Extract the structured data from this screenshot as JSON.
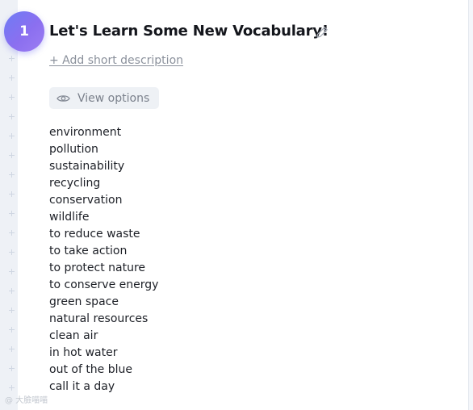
{
  "section": {
    "number": "1",
    "title": "Let's Learn Some New Vocabulary!",
    "add_description_link": "+ Add short description",
    "view_options_label": "View options"
  },
  "vocabulary": [
    "environment",
    "pollution",
    "sustainability",
    "recycling",
    "conservation",
    "wildlife",
    "to reduce waste",
    "to take action",
    "to protect nature",
    "to conserve energy",
    "green space",
    "natural resources",
    "clean air",
    "in hot water",
    "out of the blue",
    "call it a day"
  ],
  "watermark": "@ 大臉喵喵",
  "icons": {
    "edit": "pencil-icon",
    "view": "eye-icon"
  },
  "colors": {
    "badge_gradient_start": "#6d7cf5",
    "badge_gradient_end": "#9c7df2",
    "title_text": "#14161c",
    "muted_text": "#8b919c",
    "view_options_bg": "#eef1f5"
  }
}
